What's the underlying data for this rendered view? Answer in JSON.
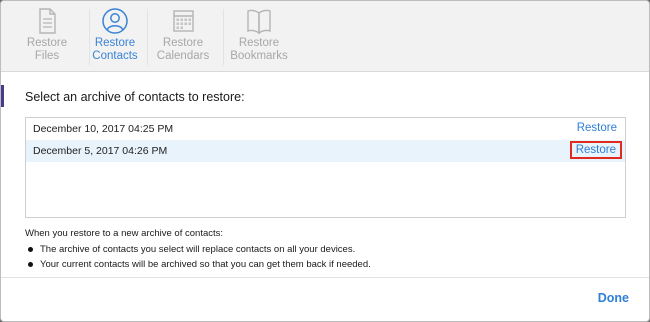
{
  "toolbar": {
    "items": [
      {
        "label": "Restore\nFiles",
        "icon": "document-icon",
        "active": false
      },
      {
        "label": "Restore\nContacts",
        "icon": "contacts-icon",
        "active": true
      },
      {
        "label": "Restore\nCalendars",
        "icon": "calendar-icon",
        "active": false
      },
      {
        "label": "Restore\nBookmarks",
        "icon": "book-icon",
        "active": false
      }
    ]
  },
  "prompt": "Select an archive of contacts to restore:",
  "archives": [
    {
      "date": "December 10, 2017 04:25 PM",
      "action": "Restore",
      "selected": false,
      "highlighted": false
    },
    {
      "date": "December 5, 2017 04:26 PM",
      "action": "Restore",
      "selected": true,
      "highlighted": true
    }
  ],
  "info": {
    "heading": "When you restore to a new archive of contacts:",
    "bullets": [
      "The archive of contacts you select will replace contacts on all your devices.",
      "Your current contacts will be archived so that you can get them back if needed."
    ]
  },
  "footer": {
    "done_label": "Done"
  },
  "colors": {
    "accent": "#2f7fd7",
    "highlight_box": "#e02a1f",
    "selected_row": "#e8f3fc"
  }
}
